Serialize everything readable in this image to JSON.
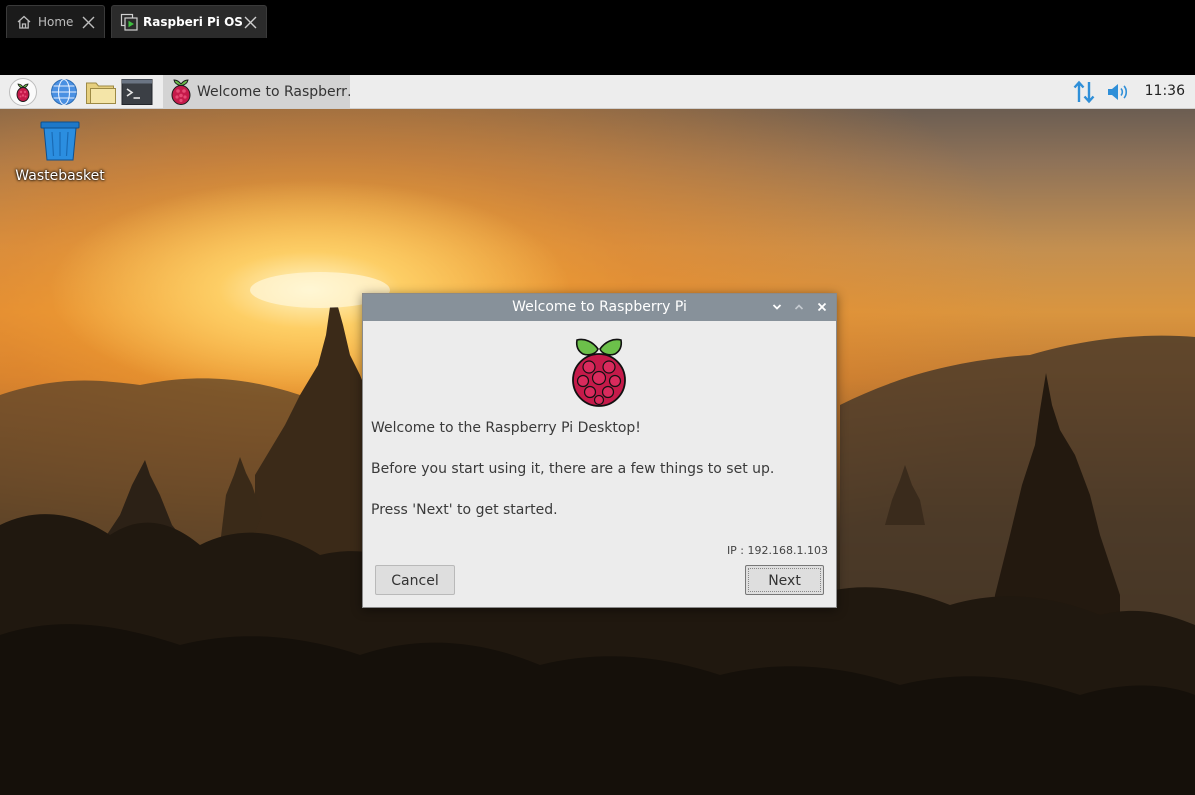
{
  "host_tabs": [
    {
      "label": "Home",
      "icon": "home-icon",
      "active": false
    },
    {
      "label": "Raspberi Pi OS",
      "icon": "vm-play-icon",
      "active": true
    }
  ],
  "panel": {
    "launchers": [
      {
        "name": "raspberry-menu-icon"
      },
      {
        "name": "web-browser-icon"
      },
      {
        "name": "file-manager-icon"
      },
      {
        "name": "terminal-icon"
      }
    ],
    "task_label": "Welcome to Raspberr…",
    "clock": "11:36",
    "tray": [
      "network-arrows-icon",
      "volume-icon"
    ]
  },
  "desktop_icons": [
    {
      "label": "Wastebasket",
      "icon": "wastebasket-icon"
    }
  ],
  "dialog": {
    "title": "Welcome to Raspberry Pi",
    "lines": [
      "Welcome to the Raspberry Pi Desktop!",
      "Before you start using it, there are a few things to set up.",
      "Press 'Next' to get started."
    ],
    "ip_text": "IP : 192.168.1.103",
    "cancel_label": "Cancel",
    "next_label": "Next"
  },
  "colors": {
    "titlebar": "#87919a",
    "dialog_bg": "#ececec",
    "panel_bg": "#ededed",
    "raspberry_red": "#c51a4a",
    "leaf_green": "#6cc04a",
    "tray_blue": "#2f8fd8"
  }
}
